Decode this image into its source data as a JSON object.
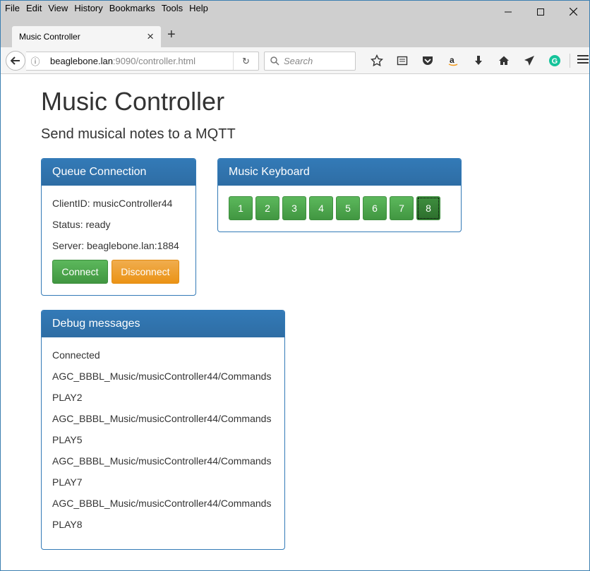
{
  "browser": {
    "menu": [
      "File",
      "Edit",
      "View",
      "History",
      "Bookmarks",
      "Tools",
      "Help"
    ],
    "tab_title": "Music Controller",
    "url_host": "beaglebone.lan",
    "url_path": ":9090/controller.html",
    "search_placeholder": "Search"
  },
  "page": {
    "title": "Music Controller",
    "subtitle": "Send musical notes to a MQTT"
  },
  "queue": {
    "heading": "Queue Connection",
    "client_id": "ClientID: musicController44",
    "status": "Status: ready",
    "server": "Server: beaglebone.lan:1884",
    "connect_label": "Connect",
    "disconnect_label": "Disconnect"
  },
  "keyboard": {
    "heading": "Music Keyboard",
    "keys": [
      "1",
      "2",
      "3",
      "4",
      "5",
      "6",
      "7",
      "8"
    ]
  },
  "debug": {
    "heading": "Debug messages",
    "messages": [
      "Connected",
      "AGC_BBBL_Music/musicController44/Commands",
      "PLAY2",
      "AGC_BBBL_Music/musicController44/Commands",
      "PLAY5",
      "AGC_BBBL_Music/musicController44/Commands",
      "PLAY7",
      "AGC_BBBL_Music/musicController44/Commands",
      "PLAY8"
    ]
  }
}
